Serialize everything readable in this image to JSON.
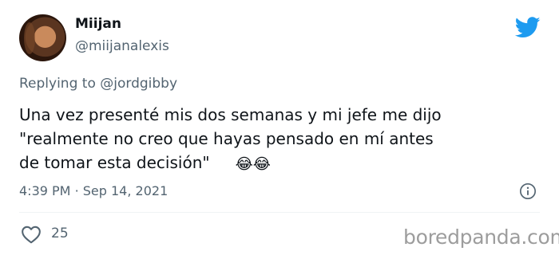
{
  "author": {
    "display_name": "Miijan",
    "handle": "@miijanalexis"
  },
  "replying_to": {
    "prefix": "Replying to",
    "handle": "@jordgibby"
  },
  "tweet": {
    "lines": [
      "Una vez presenté mis dos semanas y mi jefe me dijo",
      "\"realmente no creo que hayas pensado en mí antes",
      "de tomar esta decisión\""
    ],
    "emojis": "😂😂"
  },
  "timestamp": {
    "time": "4:39 PM",
    "separator": "·",
    "date": "Sep 14, 2021"
  },
  "engagement": {
    "likes": "25"
  },
  "watermark": "boredpanda.com",
  "colors": {
    "twitter_blue": "#1d9bf0",
    "secondary_text": "#536471",
    "primary_text": "#0f1419"
  },
  "icons": {
    "brand": "twitter-bird-icon",
    "info": "info-icon",
    "like": "heart-icon"
  }
}
